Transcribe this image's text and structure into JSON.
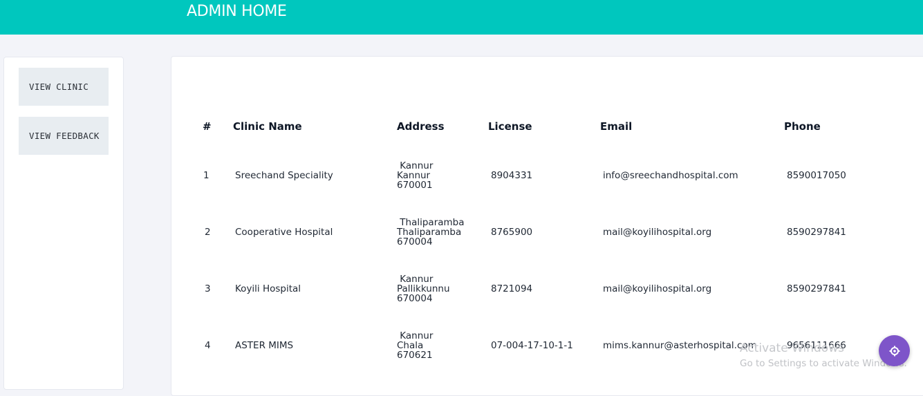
{
  "header": {
    "title": "ADMIN HOME"
  },
  "sidebar": {
    "items": [
      {
        "label": "VIEW CLINIC"
      },
      {
        "label": "VIEW FEEDBACK"
      }
    ]
  },
  "table": {
    "headers": [
      "#",
      "Clinic Name",
      "Address",
      "License",
      "Email",
      "Phone"
    ],
    "rows": [
      {
        "num": "1",
        "name": "Sreechand Speciality",
        "addr": [
          " Kannur",
          "Kannur",
          "670001"
        ],
        "license": "8904331",
        "email": "info@sreechandhospital.com",
        "phone": "8590017050"
      },
      {
        "num": "2",
        "name": "Cooperative Hospital",
        "addr": [
          " Thaliparamba",
          "Thaliparamba",
          "670004"
        ],
        "license": "8765900",
        "email": "mail@koyilihospital.org",
        "phone": "8590297841"
      },
      {
        "num": "3",
        "name": "Koyili Hospital",
        "addr": [
          " Kannur",
          "Pallikkunnu",
          "670004"
        ],
        "license": "8721094",
        "email": "mail@koyilihospital.org",
        "phone": "8590297841"
      },
      {
        "num": "4",
        "name": "ASTER MIMS",
        "addr": [
          " Kannur",
          "Chala",
          "670621"
        ],
        "license": "07-004-17-10-1-1",
        "email": "mims.kannur@asterhospital.com",
        "phone": "9656111666"
      }
    ]
  },
  "overlay": {
    "activate_title": "Activate Windows",
    "activate_sub": "Go to Settings to activate Windows.",
    "fab_icon": "gear-icon",
    "fab_color": "#7e55c9"
  },
  "colors": {
    "accent": "#00c7be"
  }
}
